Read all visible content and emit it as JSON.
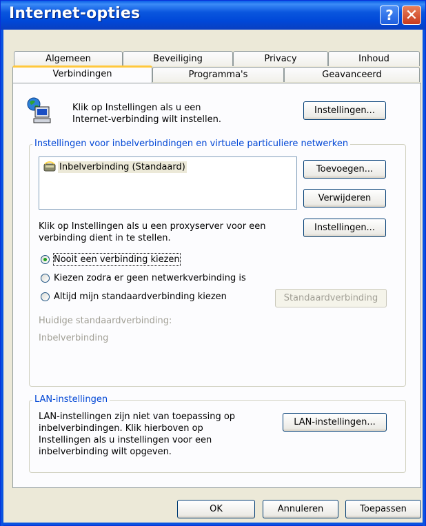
{
  "window": {
    "title": "Internet-opties",
    "help_glyph": "?",
    "close_glyph": "✕"
  },
  "tabs_row1": [
    {
      "label": "Algemeen"
    },
    {
      "label": "Beveiliging"
    },
    {
      "label": "Privacy"
    },
    {
      "label": "Inhoud"
    }
  ],
  "tabs_row2": [
    {
      "label": "Verbindingen",
      "active": true
    },
    {
      "label": "Programma's"
    },
    {
      "label": "Geavanceerd"
    }
  ],
  "setup": {
    "text_line1": "Klik op Instellingen als u een",
    "text_line2": "Internet-verbinding wilt instellen.",
    "button": "Instellingen..."
  },
  "dialup": {
    "legend": "Instellingen voor inbelverbindingen en virtuele particuliere netwerken",
    "connections": [
      {
        "name": "Inbelverbinding (Standaard)"
      }
    ],
    "add_button": "Toevoegen...",
    "remove_button": "Verwijderen",
    "proxy_text_line1": "Klik op Instellingen als u een proxyserver voor een",
    "proxy_text_line2": "verbinding dient in te stellen.",
    "settings_button": "Instellingen...",
    "options": [
      {
        "label": "Nooit een verbinding kiezen",
        "selected": true
      },
      {
        "label": "Kiezen zodra er geen netwerkverbinding is",
        "selected": false
      },
      {
        "label": "Altijd mijn standaardverbinding kiezen",
        "selected": false
      }
    ],
    "default_button": "Standaardverbinding",
    "current_default_label": "Huidige standaardverbinding:",
    "current_default_value": "Inbelverbinding"
  },
  "lan": {
    "legend": "LAN-instellingen",
    "text_line1": "LAN-instellingen zijn niet van toepassing op",
    "text_line2": "inbelverbindingen. Klik hierboven op",
    "text_line3": "Instellingen als u instellingen voor een",
    "text_line4": "inbelverbinding wilt opgeven.",
    "button": "LAN-instellingen..."
  },
  "footer": {
    "ok": "OK",
    "cancel": "Annuleren",
    "apply": "Toepassen"
  },
  "colors": {
    "title_blue": "#0a56de",
    "legend_blue": "#0046d5",
    "active_tab_accent": "#ffc83c"
  }
}
